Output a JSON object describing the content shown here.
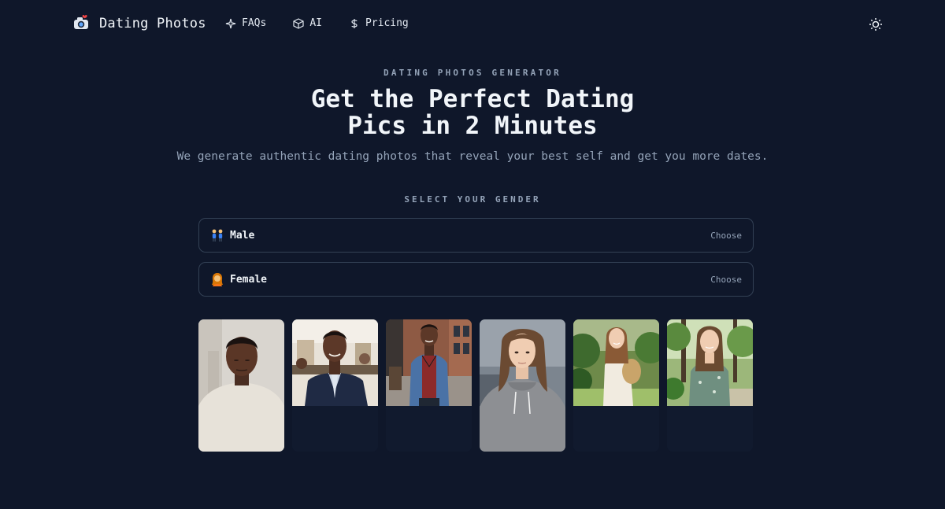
{
  "nav": {
    "brand": "Dating Photos",
    "links": [
      {
        "label": "FAQs",
        "icon": "sparkle-icon"
      },
      {
        "label": "AI",
        "icon": "cube-icon"
      },
      {
        "label": "Pricing",
        "icon": "dollar-icon"
      }
    ],
    "theme_icon": "sun-icon"
  },
  "hero": {
    "eyebrow": "DATING PHOTOS GENERATOR",
    "headline_line1": "Get the Perfect Dating",
    "headline_line2": "Pics in 2 Minutes",
    "subhead": "We generate authentic dating photos that reveal your best self and get you more dates."
  },
  "gender": {
    "label": "SELECT YOUR GENDER",
    "options": [
      {
        "label": "Male",
        "action": "Choose",
        "icon": "man-emoji-icon"
      },
      {
        "label": "Female",
        "action": "Choose",
        "icon": "woman-emoji-icon"
      }
    ]
  },
  "colors": {
    "background": "#0f172a",
    "border": "#334155",
    "text": "#e2e8f0",
    "muted": "#94a3b8"
  }
}
